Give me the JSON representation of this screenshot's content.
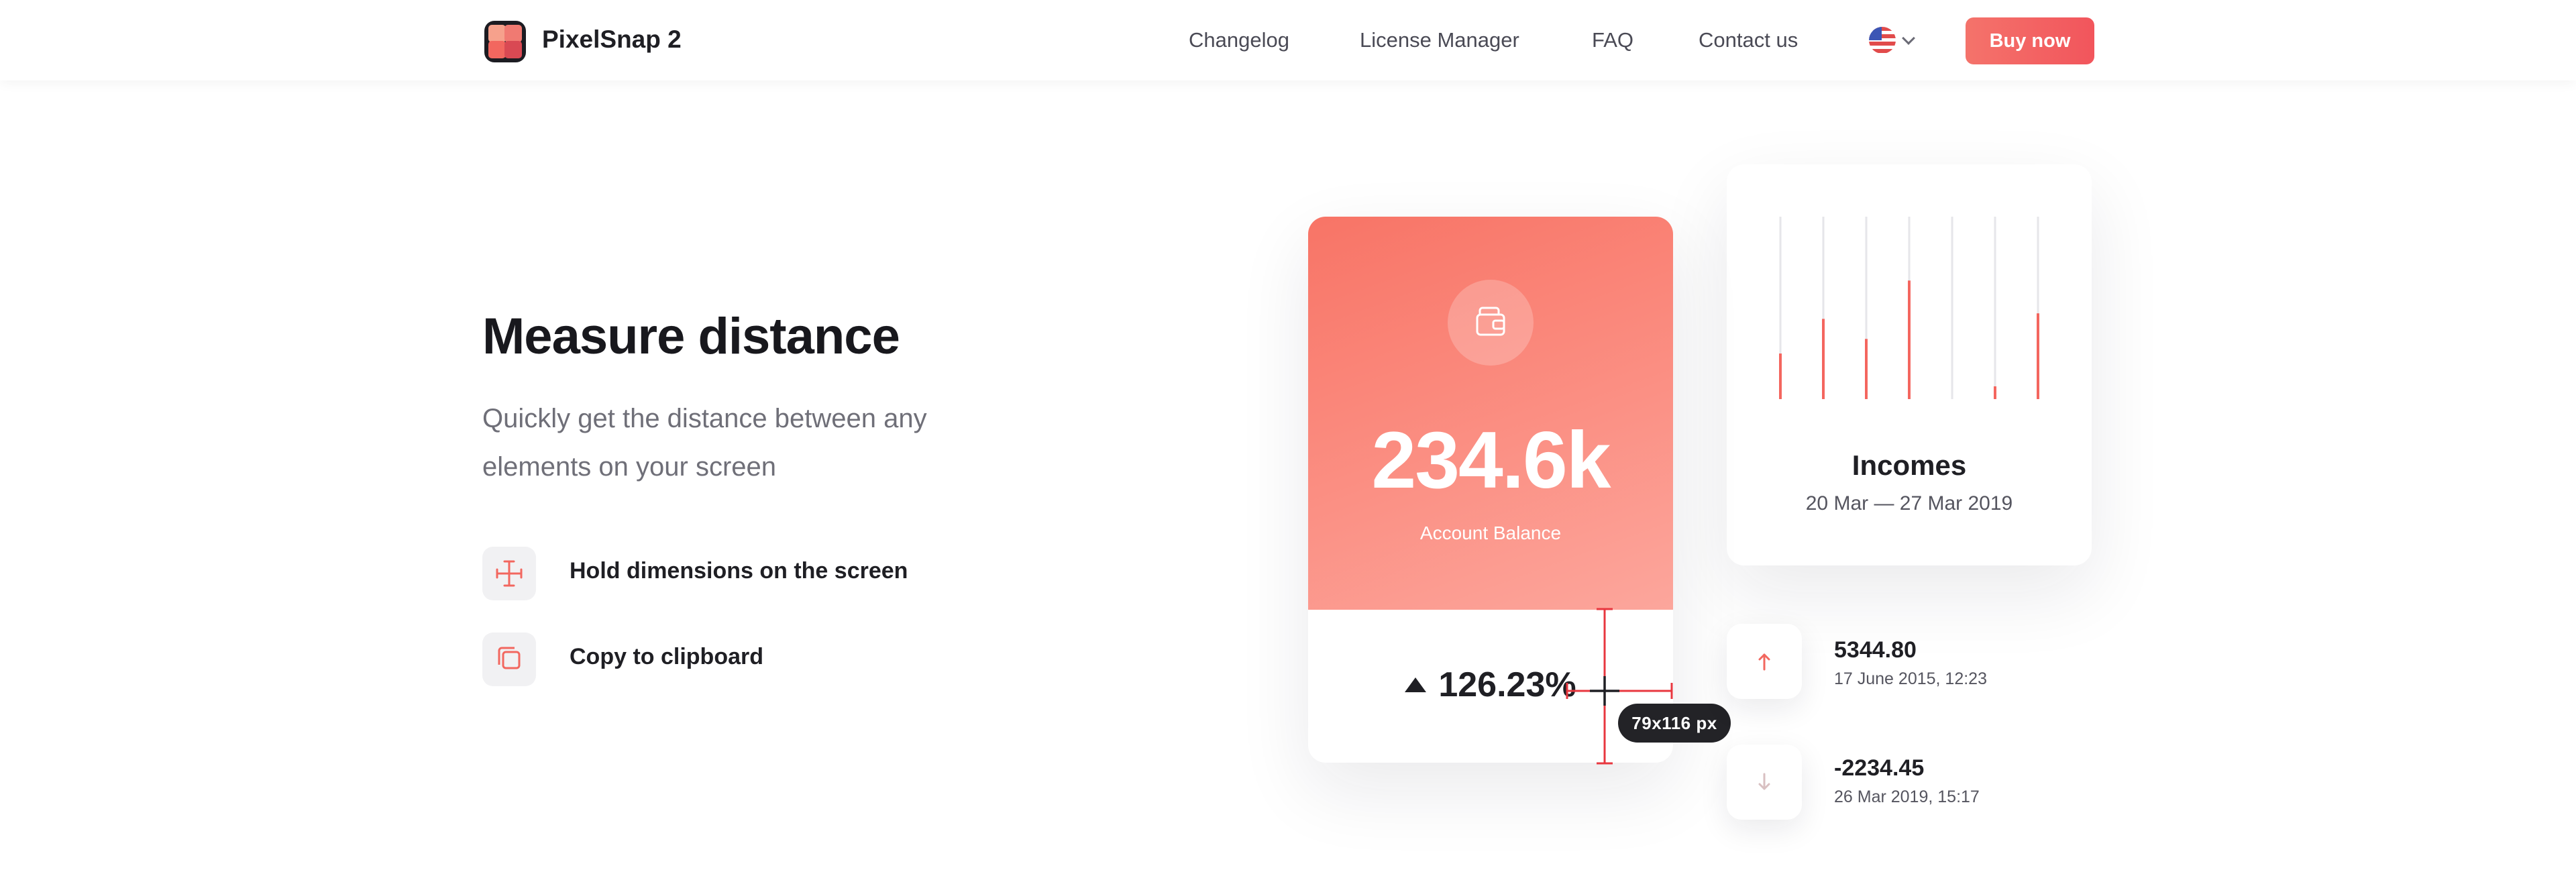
{
  "header": {
    "brand": "PixelSnap 2",
    "nav": [
      {
        "label": "Changelog"
      },
      {
        "label": "License Manager"
      },
      {
        "label": "FAQ"
      },
      {
        "label": "Contact us"
      }
    ],
    "language_icon": "us-flag-icon",
    "buy_label": "Buy now"
  },
  "hero": {
    "title": "Measure distance",
    "subtitle": "Quickly get the distance between any elements on your screen",
    "features": [
      {
        "icon": "dimensions-icon",
        "label": "Hold dimensions on the screen"
      },
      {
        "icon": "copy-icon",
        "label": "Copy to clipboard"
      }
    ]
  },
  "balance_card": {
    "icon": "wallet-icon",
    "amount": "234.6k",
    "label": "Account Balance",
    "change_icon": "triangle-up-icon",
    "change": "126.23%"
  },
  "measurement": {
    "tooltip": "79x116 px"
  },
  "incomes": {
    "title": "Incomes",
    "date_range": "20 Mar — 27 Mar 2019",
    "bar_levels": [
      0.25,
      0.44,
      0.33,
      0.65,
      0,
      0.07,
      0.47
    ]
  },
  "transactions": [
    {
      "direction": "up",
      "icon": "arrow-up-icon",
      "amount": "5344.80",
      "date": "17 June 2015, 12:23"
    },
    {
      "direction": "down",
      "icon": "arrow-down-icon",
      "amount": "-2234.45",
      "date": "26 Mar 2019, 15:17"
    }
  ],
  "colors": {
    "accent": "#f4665f",
    "card_gradient_start": "#f87466",
    "card_gradient_end": "#fca69c",
    "dark": "#1f1f24"
  }
}
